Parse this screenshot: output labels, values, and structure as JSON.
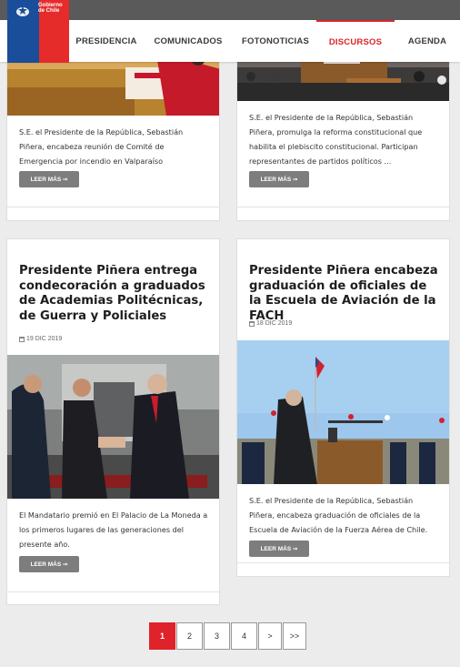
{
  "logo": {
    "line1": "Gobierno",
    "line2": "de Chile"
  },
  "nav": {
    "items": [
      {
        "label": "PRESIDENCIA"
      },
      {
        "label": "COMUNICADOS"
      },
      {
        "label": "FOTONOTICIAS"
      },
      {
        "label": "DISCURSOS"
      },
      {
        "label": "AGENDA"
      }
    ],
    "active_index": 3
  },
  "cards": [
    {
      "description": "S.E. el Presidente de la República, Sebastián Piñera, encabeza reunión de Comité de Emergencia por incendio en Valparaíso",
      "button": "LEER MÁS ➞"
    },
    {
      "description": "S.E. el Presidente de la República, Sebastián Piñera, promulga la reforma constitucional que habilita el plebiscito constitucional. Participan representantes de partidos políticos ...",
      "button": "LEER MÁS ➞"
    },
    {
      "title": "Presidente Piñera entrega condecoración a graduados de Academias Politécnicas, de Guerra y Policiales",
      "date": "19 DIC 2019",
      "description": "El Mandatario premió en El Palacio de La Moneda a los primeros lugares de las generaciones del presente año.",
      "button": "LEER MÁS ➞"
    },
    {
      "title": "Presidente Piñera encabeza graduación de oficiales de la Escuela de Aviación de la FACH",
      "date": "18 DIC 2019",
      "description": "S.E. el Presidente de la República, Sebastián Piñera, encabeza graduación de oficiales de la Escuela de Aviación de la Fuerza Aérea de Chile.",
      "button": "LEER MÁS ➞"
    }
  ],
  "pagination": {
    "pages": [
      "1",
      "2",
      "3",
      "4"
    ],
    "next": ">",
    "last": ">>",
    "current": "1"
  },
  "colors": {
    "accent": "#e0222a",
    "brand_blue": "#1a4e9a",
    "button_gray": "#7d7d7d"
  }
}
